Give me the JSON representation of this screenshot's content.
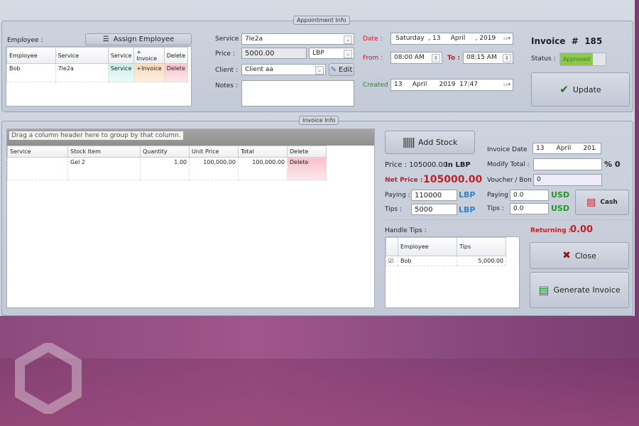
{
  "appointment": {
    "group_title": "Appointment Info",
    "employee_label": "Employee :",
    "assign_employee": "Assign Employee",
    "emp_grid": {
      "headers": [
        "Employee",
        "Service",
        "Service",
        "+ Invoice",
        "Delete"
      ],
      "rows": [
        {
          "employee": "Bob",
          "service": "7le2a",
          "service_btn": "Service",
          "invoice_btn": "+Invoice",
          "delete_btn": "Delete"
        }
      ]
    },
    "service_label": "Service :",
    "service_value": "7le2a",
    "price_label": "Price :",
    "price_value": "5000.00",
    "currency": "LBP",
    "client_label": "Client :",
    "client_value": "Client aa",
    "edit": "Edit",
    "notes_label": "Notes :",
    "notes_value": "",
    "date_label": "Date :",
    "date_value": "Saturday  , 13     April     , 2019",
    "from_label": "From :",
    "from_value": "08:00 AM",
    "to_label": "To :",
    "to_value": "08:15 AM",
    "created_label": "Created :",
    "created_value": "13     April      2019  17:47",
    "invoice_title": "Invoice  #  185",
    "status_label": "Status :",
    "status_value": "Approved",
    "update": "Update"
  },
  "invoice": {
    "group_title": "Invoice Info",
    "group_hint": "Drag a column header here to group by that column.",
    "headers": [
      "Service",
      "Stock Item",
      "Quantity",
      "Unit Price",
      "Total",
      "Delete"
    ],
    "rows": [
      {
        "service": "",
        "stock_item": "Gel 2",
        "quantity": "1.00",
        "unit_price": "100,000.00",
        "total": "100,000.00",
        "delete": "Delete"
      }
    ],
    "add_stock": "Add Stock",
    "price_text": "Price : 105000.00",
    "in_currency": "In LBP",
    "net_price_label": "Net Price :",
    "net_price_value": "105000.00",
    "paying_label": "Paying :",
    "paying_value": "110000",
    "paying_currency": "LBP",
    "tips_label": "Tips :",
    "tips_value": "5000",
    "tips_currency": "LBP",
    "invoice_date_label": "Invoice Date",
    "invoice_date_value": "13      April      201",
    "modify_total_label": "Modify Total :",
    "modify_total_value": "",
    "percent": "% 0",
    "voucher_label": "Voucher / Bon #",
    "voucher_value": "0",
    "usd_paying_label": "Paying :",
    "usd_paying_value": "0.0",
    "usd_label": "USD",
    "usd_tips_label": "Tips :",
    "usd_tips_value": "0.0",
    "cash": "Cash",
    "handle_tips_label": "Handle Tips :",
    "tips_grid": {
      "headers": [
        "",
        "Employee",
        "Tips"
      ],
      "rows": [
        {
          "checked": true,
          "employee": "Bob",
          "tips": "5,000.00"
        }
      ]
    },
    "returning_label": "Returning :",
    "returning_value": "0.00",
    "close": "Close",
    "generate": "Generate Invoice"
  },
  "colors": {
    "red": "#c0202a",
    "blue": "#3a7fc0",
    "green": "#1f9a1f",
    "approved": "#8cc84b"
  }
}
